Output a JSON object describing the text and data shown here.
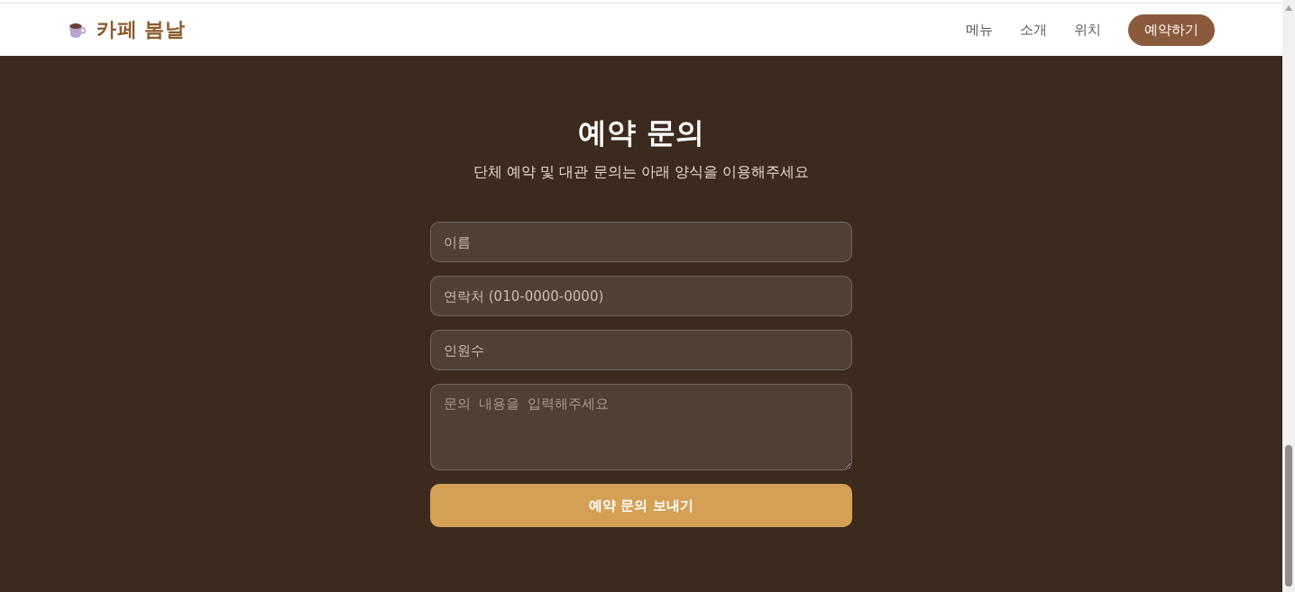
{
  "header": {
    "logo": {
      "text": "카페 봄날"
    },
    "nav": [
      {
        "label": "메뉴"
      },
      {
        "label": "소개"
      },
      {
        "label": "위치"
      }
    ],
    "cta": {
      "label": "예약하기"
    }
  },
  "reservation": {
    "title": "예약 문의",
    "subtitle": "단체 예약 및 대관 문의는 아래 양식을 이용해주세요",
    "fields": [
      {
        "kind": "input",
        "placeholder": "이름"
      },
      {
        "kind": "input",
        "placeholder": "연락처 (010-0000-0000)"
      },
      {
        "kind": "input",
        "placeholder": "인원수"
      },
      {
        "kind": "textarea",
        "placeholder": "문의 내용을 입력해주세요"
      }
    ],
    "submit": {
      "label": "예약 문의 보내기"
    }
  }
}
